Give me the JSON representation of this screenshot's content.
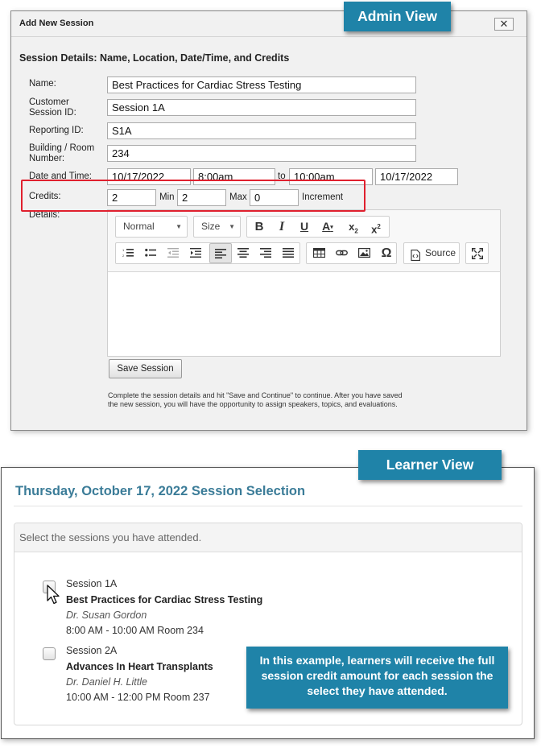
{
  "admin": {
    "badge": "Admin View",
    "dialog_title": "Add New Session",
    "close_glyph": "✕",
    "section_heading": "Session Details: Name, Location, Date/Time, and Credits",
    "labels": {
      "name": "Name:",
      "customer_session_id": "Customer Session ID:",
      "reporting_id": "Reporting ID:",
      "building_room": "Building / Room Number:",
      "date_time": "Date and Time:",
      "to": "to",
      "credits": "Credits:",
      "min": "Min",
      "max": "Max",
      "increment": "Increment",
      "details": "Details:"
    },
    "values": {
      "name": "Best Practices for Cardiac Stress Testing",
      "customer_session_id": "Session 1A",
      "reporting_id": "S1A",
      "building_room": "234",
      "start_date": "10/17/2022",
      "start_time": "8:00am",
      "end_time": "10:00am",
      "end_date": "10/17/2022",
      "credits": "2",
      "min": "2",
      "max": "0"
    },
    "editor": {
      "format_combo": "Normal",
      "size_combo": "Size",
      "source_label": "Source",
      "icons": [
        "bold-icon",
        "italic-icon",
        "underline-icon",
        "text-color-icon",
        "subscript-icon",
        "superscript-icon",
        "numbered-list-icon",
        "bulleted-list-icon",
        "outdent-icon",
        "indent-icon",
        "align-left-icon",
        "align-center-icon",
        "align-right-icon",
        "justify-icon",
        "table-icon",
        "link-icon",
        "image-icon",
        "special-char-icon",
        "source-icon",
        "maximize-icon"
      ]
    },
    "save_button": "Save Session",
    "help_text": "Complete the session details and hit \"Save and Continue\" to continue. After you have saved the new session, you will have the opportunity to assign speakers, topics, and evaluations."
  },
  "learner": {
    "badge": "Learner View",
    "title": "Thursday, October 17, 2022 Session Selection",
    "panel_heading": "Select the sessions you have attended.",
    "sessions": [
      {
        "code": "Session 1A",
        "title": "Best Practices for Cardiac Stress Testing",
        "speaker": "Dr. Susan Gordon",
        "time_room": "8:00 AM - 10:00 AM Room 234",
        "checked": false
      },
      {
        "code": "Session 2A",
        "title": "Advances In Heart Transplants",
        "speaker": "Dr. Daniel H. Little",
        "time_room": "10:00 AM - 12:00 PM Room 237",
        "checked": false
      }
    ],
    "callout": "In this example, learners will receive the full session credit amount for each session the select they have attended."
  },
  "colors": {
    "badge_blue": "#1f83a8",
    "highlight_red": "#e0202e",
    "title_blue": "#3b7c98"
  }
}
